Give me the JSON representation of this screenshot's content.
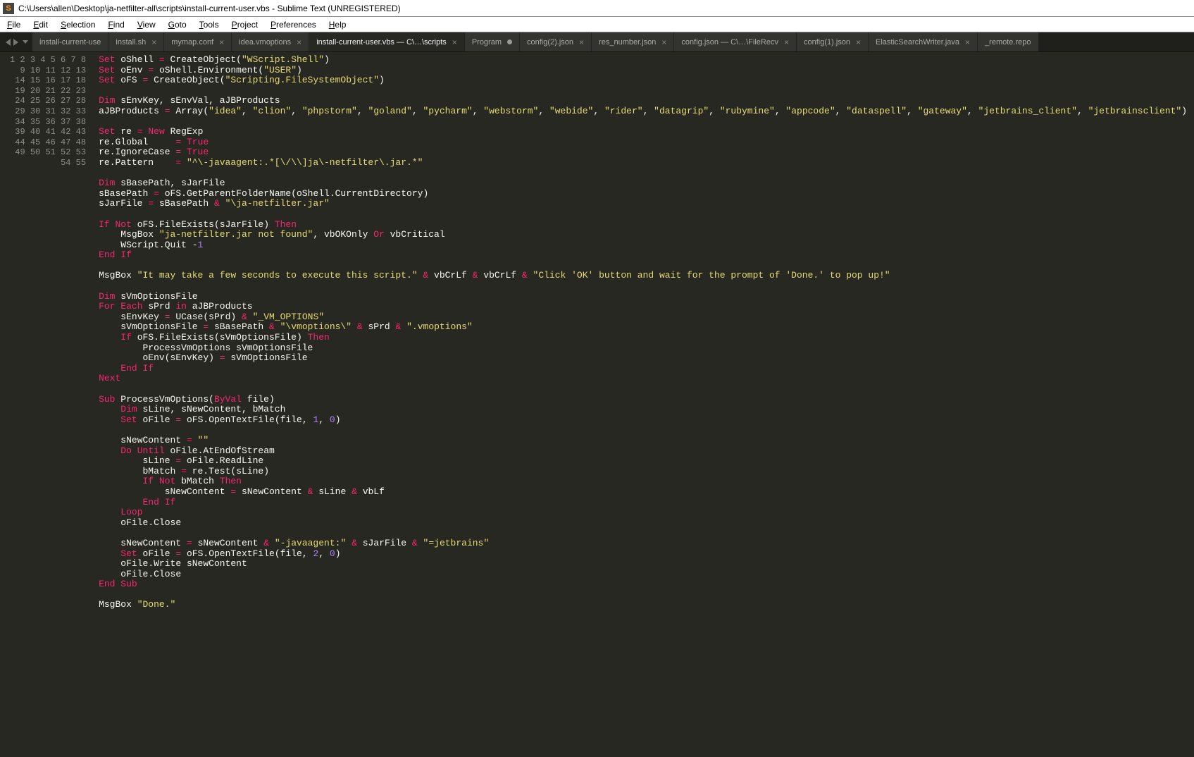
{
  "window": {
    "title": "C:\\Users\\allen\\Desktop\\ja-netfilter-all\\scripts\\install-current-user.vbs - Sublime Text (UNREGISTERED)"
  },
  "menu": {
    "items": [
      "File",
      "Edit",
      "Selection",
      "Find",
      "View",
      "Goto",
      "Tools",
      "Project",
      "Preferences",
      "Help"
    ]
  },
  "tabs": [
    {
      "label": "install-current-use",
      "dirty": false,
      "active": false,
      "closable": false
    },
    {
      "label": "install.sh",
      "dirty": false,
      "active": false,
      "closable": true
    },
    {
      "label": "mymap.conf",
      "dirty": false,
      "active": false,
      "closable": true
    },
    {
      "label": "idea.vmoptions",
      "dirty": false,
      "active": false,
      "closable": true
    },
    {
      "label": "install-current-user.vbs — C\\…\\scripts",
      "dirty": false,
      "active": true,
      "closable": true
    },
    {
      "label": "Program",
      "dirty": true,
      "active": false,
      "closable": false
    },
    {
      "label": "config(2).json",
      "dirty": false,
      "active": false,
      "closable": true
    },
    {
      "label": "res_number.json",
      "dirty": false,
      "active": false,
      "closable": true
    },
    {
      "label": "config.json — C\\…\\FileRecv",
      "dirty": false,
      "active": false,
      "closable": true
    },
    {
      "label": "config(1).json",
      "dirty": false,
      "active": false,
      "closable": true
    },
    {
      "label": "ElasticSearchWriter.java",
      "dirty": false,
      "active": false,
      "closable": true
    },
    {
      "label": "_remote.repo",
      "dirty": false,
      "active": false,
      "closable": false
    }
  ],
  "source": {
    "lines": [
      "Set oShell = CreateObject(\"WScript.Shell\")",
      "Set oEnv = oShell.Environment(\"USER\")",
      "Set oFS = CreateObject(\"Scripting.FileSystemObject\")",
      "",
      "Dim sEnvKey, sEnvVal, aJBProducts",
      "aJBProducts = Array(\"idea\", \"clion\", \"phpstorm\", \"goland\", \"pycharm\", \"webstorm\", \"webide\", \"rider\", \"datagrip\", \"rubymine\", \"appcode\", \"dataspell\", \"gateway\", \"jetbrains_client\", \"jetbrainsclient\")",
      "",
      "Set re = New RegExp",
      "re.Global     = True",
      "re.IgnoreCase = True",
      "re.Pattern    = \"^\\-javaagent:.*[\\/\\\\]ja\\-netfilter\\.jar.*\"",
      "",
      "Dim sBasePath, sJarFile",
      "sBasePath = oFS.GetParentFolderName(oShell.CurrentDirectory)",
      "sJarFile = sBasePath & \"\\ja-netfilter.jar\"",
      "",
      "If Not oFS.FileExists(sJarFile) Then",
      "    MsgBox \"ja-netfilter.jar not found\", vbOKOnly Or vbCritical",
      "    WScript.Quit -1",
      "End If",
      "",
      "MsgBox \"It may take a few seconds to execute this script.\" & vbCrLf & vbCrLf & \"Click 'OK' button and wait for the prompt of 'Done.' to pop up!\"",
      "",
      "Dim sVmOptionsFile",
      "For Each sPrd in aJBProducts",
      "    sEnvKey = UCase(sPrd) & \"_VM_OPTIONS\"",
      "    sVmOptionsFile = sBasePath & \"\\vmoptions\\\" & sPrd & \".vmoptions\"",
      "    If oFS.FileExists(sVmOptionsFile) Then",
      "        ProcessVmOptions sVmOptionsFile",
      "        oEnv(sEnvKey) = sVmOptionsFile",
      "    End If",
      "Next",
      "",
      "Sub ProcessVmOptions(ByVal file)",
      "    Dim sLine, sNewContent, bMatch",
      "    Set oFile = oFS.OpenTextFile(file, 1, 0)",
      "",
      "    sNewContent = \"\"",
      "    Do Until oFile.AtEndOfStream",
      "        sLine = oFile.ReadLine",
      "        bMatch = re.Test(sLine)",
      "        If Not bMatch Then",
      "            sNewContent = sNewContent & sLine & vbLf",
      "        End If",
      "    Loop",
      "    oFile.Close",
      "",
      "    sNewContent = sNewContent & \"-javaagent:\" & sJarFile & \"=jetbrains\"",
      "    Set oFile = oFS.OpenTextFile(file, 2, 0)",
      "    oFile.Write sNewContent",
      "    oFile.Close",
      "End Sub",
      "",
      "MsgBox \"Done.\"",
      ""
    ]
  }
}
